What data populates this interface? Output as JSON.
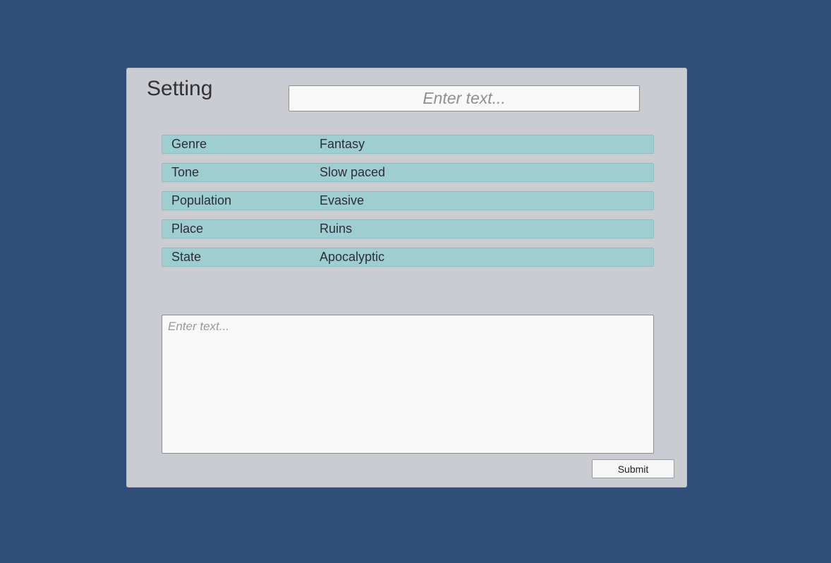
{
  "panel": {
    "title": "Setting",
    "title_input": {
      "value": "",
      "placeholder": "Enter text..."
    },
    "rows": [
      {
        "key": "Genre",
        "value": "Fantasy"
      },
      {
        "key": "Tone",
        "value": "Slow paced"
      },
      {
        "key": "Population",
        "value": "Evasive"
      },
      {
        "key": "Place",
        "value": "Ruins"
      },
      {
        "key": "State",
        "value": "Apocalyptic"
      }
    ],
    "text_area": {
      "value": "",
      "placeholder": "Enter text..."
    },
    "submit_label": "Submit"
  },
  "colors": {
    "background": "#314d79",
    "panel": "#cbccd1",
    "row": "#9fced2"
  }
}
